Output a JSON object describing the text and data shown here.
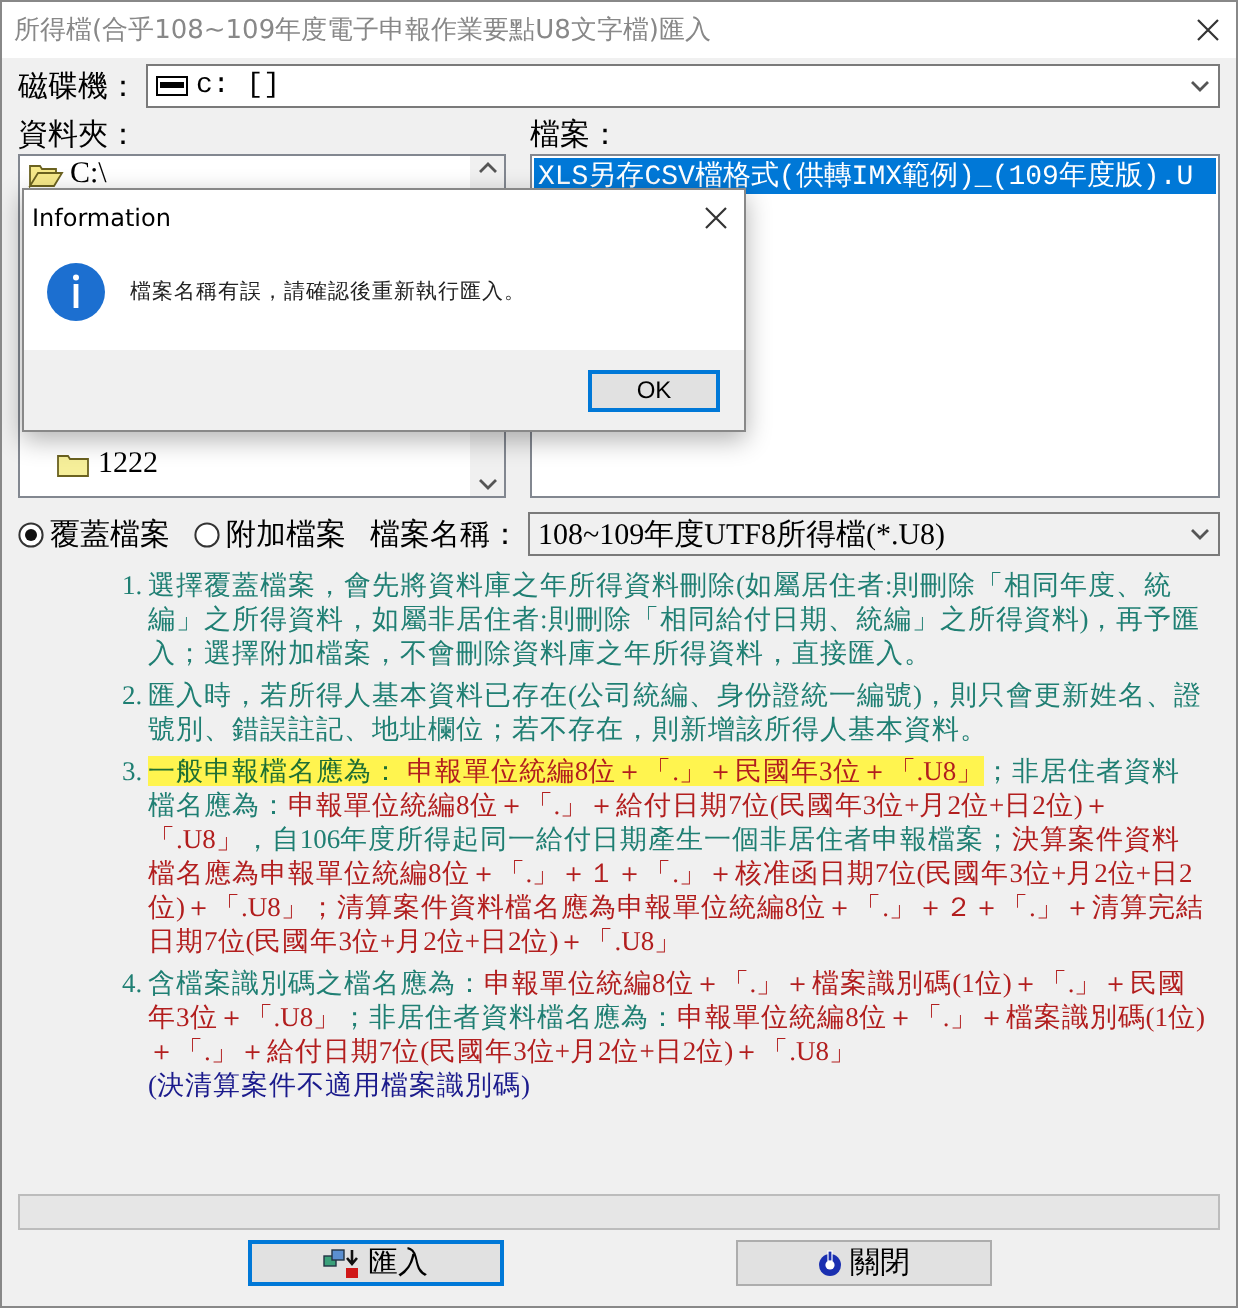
{
  "window": {
    "title": "所得檔(合乎108~109年度電子申報作業要點U8文字檔)匯入"
  },
  "drive": {
    "label": "磁碟機：",
    "value": "c: []"
  },
  "folder": {
    "label": "資料夾：",
    "items": [
      {
        "name": "C:\\",
        "open": true
      },
      {
        "name": "1222",
        "open": false
      }
    ]
  },
  "file": {
    "label": "檔案：",
    "items": [
      {
        "name": "XLS另存CSV檔格式(供轉IMX範例)_(109年度版).U",
        "selected": true
      }
    ]
  },
  "mode": [
    {
      "label": "覆蓋檔案",
      "selected": true
    },
    {
      "label": "附加檔案",
      "selected": false
    }
  ],
  "file_type": {
    "label": "檔案名稱：",
    "value": "108~109年度UTF8所得檔(*.U8)"
  },
  "instructions": [
    {
      "number": "1.",
      "segments": [
        {
          "kind": "note",
          "text": "選擇覆蓋檔案，會先將資料庫之年所得資料刪除(如屬居住者:則刪除「相同年度、統編」之所得資料，如屬非居住者:則刪除「相同給付日期、統編」之所得資料)，再予匯入；選擇附加檔案，不會刪除資料庫之年所得資料，直接匯入。"
        }
      ]
    },
    {
      "number": "2.",
      "segments": [
        {
          "kind": "note",
          "text": "匯入時，若所得人基本資料已存在(公司統編、身份證統一編號)，則只會更新姓名、證號別、錯誤註記、地址欄位；若不存在，則新增該所得人基本資料。"
        }
      ]
    },
    {
      "number": "3.",
      "segments": [
        {
          "kind": "highlight",
          "text": "一般申報檔名應為："
        },
        {
          "kind": "highlight-rule",
          "text": " 申報單位統編8位＋「.」＋民國年3位＋「.U8」"
        },
        {
          "kind": "note",
          "text": "；非居住者資料檔名應為："
        },
        {
          "kind": "rule",
          "text": "申報單位統編8位＋「.」＋給付日期7位(民國年3位+月2位+日2位)＋「.U8」"
        },
        {
          "kind": "note",
          "text": "，自106年度所得起同一給付日期產生一個非居住者申報檔案；"
        },
        {
          "kind": "rule",
          "text": "決算案件資料檔名應為申報單位統編8位＋「.」＋１＋「.」＋核准函日期7位(民國年3位+月2位+日2位)＋「.U8」；清算案件資料檔名應為申報單位統編8位＋「.」＋２＋「.」＋清算完結日期7位(民國年3位+月2位+日2位)＋「.U8」"
        }
      ]
    },
    {
      "number": "4.",
      "segments": [
        {
          "kind": "note",
          "text": "含檔案識別碼之檔名應為："
        },
        {
          "kind": "rule",
          "text": "申報單位統編8位＋「.」＋檔案識別碼(1位)＋「.」＋民國年3位＋「.U8」"
        },
        {
          "kind": "note",
          "text": "；非居住者資料檔名應為："
        },
        {
          "kind": "rule",
          "text": "申報單位統編8位＋「.」＋檔案識別碼(1位)＋「.」＋給付日期7位(民國年3位+月2位+日2位)＋「.U8」"
        }
      ],
      "remark": "(決清算案件不適用檔案識別碼)"
    }
  ],
  "buttons": [
    {
      "label": "匯入",
      "kind": "import",
      "focused": true
    },
    {
      "label": "關閉",
      "kind": "close",
      "focused": false
    }
  ],
  "dialog": {
    "title": "Information",
    "message": "檔案名稱有誤，請確認後重新執行匯入。",
    "button": "OK"
  }
}
